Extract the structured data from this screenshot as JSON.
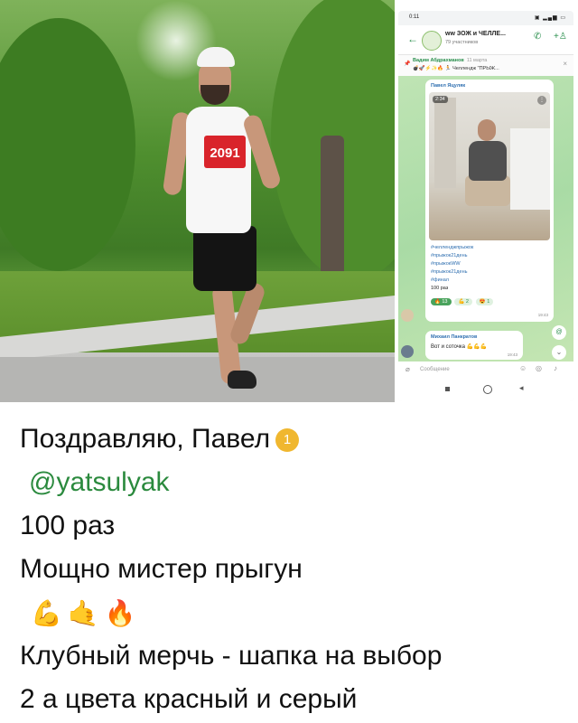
{
  "photo": {
    "bib_number": "2091"
  },
  "phone": {
    "status_time": "0:11",
    "status_icons": "▣ ▂▄▆ ▭",
    "back_icon": "←",
    "group_name": "ww ЗОЖ и ЧЕЛЛЕ...",
    "group_subtitle": "79 участников",
    "call_icon": "✆",
    "adduser_icon": "+♙",
    "pinned": {
      "author": "Вадим Абдрахманов",
      "date": "11 марта",
      "text": "💣🚀⚡✨🔥 🏃 Челлендж \"ПРЫЖ...",
      "close": "×"
    },
    "video_message": {
      "author": "Павел Яцуляк",
      "duration": "2:34",
      "tags": [
        "#челленджпрыжок",
        "#прыжок21день",
        "#прыжокWW",
        "#прыжок21день",
        "#финал"
      ],
      "count_text": "100 раз",
      "reactions": [
        "🔥 13",
        "💪 2",
        "😍 1"
      ],
      "time": "19:43"
    },
    "reply_message": {
      "author": "Михаил Панкратов",
      "text": "Вот и соточка 💪💪💪",
      "time": "19:43"
    },
    "input_placeholder": "Сообщение"
  },
  "caption": {
    "line1": "Поздравляю, Павел",
    "medal": "1",
    "mention": "@yatsulyak",
    "line3": "100 раз",
    "line4": "Мощно мистер прыгун",
    "emojis": [
      "💪",
      "🤙",
      "🔥"
    ],
    "line6": "Клубный мерчь - шапка на выбор",
    "line7": "2 а цвета красный и серый"
  }
}
